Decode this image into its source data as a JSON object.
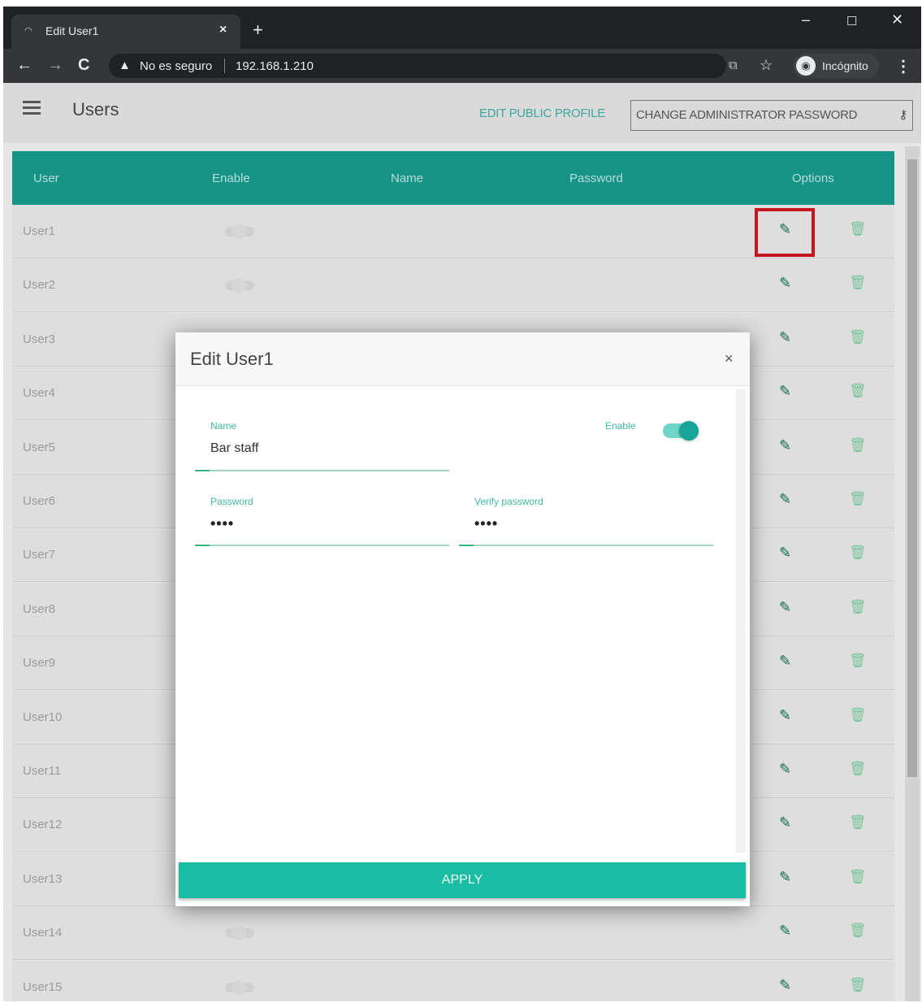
{
  "browser": {
    "tab_title": "Edit User1",
    "tab_close": "×",
    "new_tab": "+",
    "window_controls": {
      "minimize": "–",
      "maximize": "☐",
      "close": "✕"
    },
    "security_label": "No es seguro",
    "url": "192.168.1.210",
    "incognito_label": "Incógnito"
  },
  "appbar": {
    "title": "Users",
    "edit_profile_link": "EDIT PUBLIC PROFILE",
    "change_password_button": "CHANGE ADMINISTRATOR PASSWORD"
  },
  "table": {
    "headers": [
      "User",
      "Enable",
      "Name",
      "Password",
      "Options"
    ],
    "rows": [
      "User1",
      "User2",
      "User3",
      "User4",
      "User5",
      "User6",
      "User7",
      "User8",
      "User9",
      "User10",
      "User11",
      "User12",
      "User13",
      "User14",
      "User15"
    ]
  },
  "modal": {
    "title": "Edit User1",
    "close": "×",
    "name_label": "Name",
    "name_value": "Bar staff",
    "enable_label": "Enable",
    "enable_on": true,
    "password_label": "Password",
    "password_value": "••••",
    "verify_label": "Verify password",
    "verify_value": "••••",
    "apply_label": "APPLY"
  },
  "colors": {
    "header_teal": "#159485",
    "accent": "#1bbca4",
    "highlight_red": "#c4161c"
  },
  "icons": [
    "back-icon",
    "forward-icon",
    "reload-icon",
    "warning-icon",
    "translate-icon",
    "star-icon",
    "incognito-icon",
    "menu-icon",
    "hamburger-icon",
    "key-icon",
    "edit-icon",
    "delete-icon",
    "close-icon"
  ]
}
